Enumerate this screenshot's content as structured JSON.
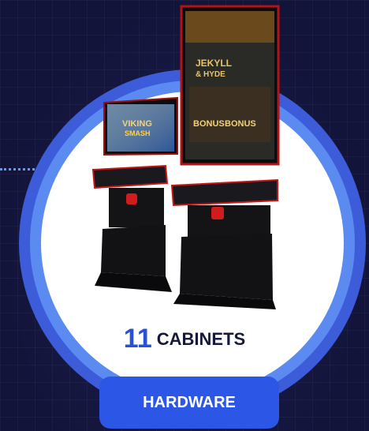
{
  "caption": {
    "count": "11",
    "label": "CABINETS"
  },
  "button": {
    "label": "HARDWARE"
  },
  "screens": {
    "left_game_line1": "VIKING",
    "left_game_line2": "SMASH",
    "right_game_line1": "JEKYLL",
    "right_game_line2": "& HYDE",
    "bonus_label": "BONUS"
  },
  "colors": {
    "accent": "#2a4fd8",
    "ring_outer": "#3c5cd9",
    "ring_mid": "#5b8bf0",
    "button": "#2b56e6"
  }
}
